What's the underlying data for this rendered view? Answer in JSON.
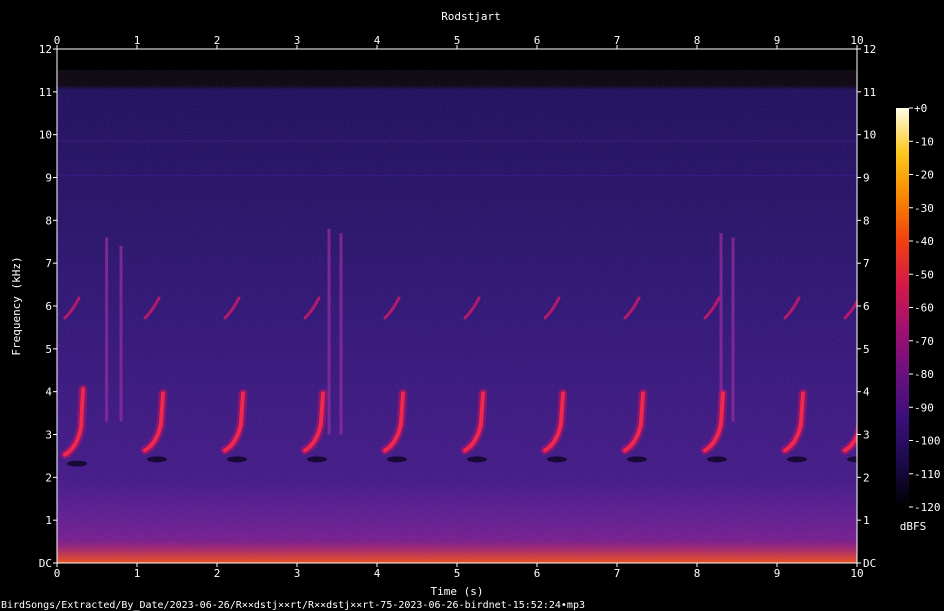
{
  "chart_data": {
    "type": "heatmap",
    "title": "Rodstjart",
    "xlabel": "Time (s)",
    "ylabel": "Frequency (kHz)",
    "xlim": [
      0,
      10
    ],
    "ylim": [
      0,
      12
    ],
    "x_ticks": [
      "0",
      "1",
      "2",
      "3",
      "4",
      "5",
      "6",
      "7",
      "8",
      "9",
      "10"
    ],
    "y_ticks": [
      "DC",
      "1",
      "2",
      "3",
      "4",
      "5",
      "6",
      "7",
      "8",
      "9",
      "10",
      "11",
      "12"
    ],
    "colorbar": {
      "label": "dBFS",
      "range": [
        -120,
        0
      ],
      "ticks": [
        "+0",
        "-10",
        "-20",
        "-30",
        "-40",
        "-50",
        "-60",
        "-70",
        "-80",
        "-90",
        "-100",
        "-110",
        "-120"
      ],
      "colors": [
        "#000000",
        "#1a0a4a",
        "#3a0f7a",
        "#6a1080",
        "#a01070",
        "#d4184a",
        "#f04010",
        "#f88800",
        "#fcc81e",
        "#fffde8"
      ]
    },
    "song_elements": [
      {
        "t": 0.2,
        "low_khz": 2.6,
        "high_khz": 4.2,
        "upper_khz": 6.0
      },
      {
        "t": 1.2,
        "low_khz": 2.7,
        "high_khz": 4.1,
        "upper_khz": 6.0
      },
      {
        "t": 2.2,
        "low_khz": 2.7,
        "high_khz": 4.1,
        "upper_khz": 6.0
      },
      {
        "t": 3.2,
        "low_khz": 2.7,
        "high_khz": 4.1,
        "upper_khz": 6.0
      },
      {
        "t": 4.2,
        "low_khz": 2.7,
        "high_khz": 4.1,
        "upper_khz": 6.0
      },
      {
        "t": 5.2,
        "low_khz": 2.7,
        "high_khz": 4.1,
        "upper_khz": 6.0
      },
      {
        "t": 6.2,
        "low_khz": 2.7,
        "high_khz": 4.1,
        "upper_khz": 6.0
      },
      {
        "t": 7.2,
        "low_khz": 2.7,
        "high_khz": 4.1,
        "upper_khz": 6.0
      },
      {
        "t": 8.2,
        "low_khz": 2.7,
        "high_khz": 4.1,
        "upper_khz": 6.0
      },
      {
        "t": 9.2,
        "low_khz": 2.7,
        "high_khz": 4.1,
        "upper_khz": 6.0
      },
      {
        "t": 9.95,
        "low_khz": 2.7,
        "high_khz": 3.5,
        "upper_khz": 6.0
      }
    ],
    "clicks": [
      {
        "t": 0.62,
        "low_khz": 3.3,
        "high_khz": 7.6
      },
      {
        "t": 0.8,
        "low_khz": 3.3,
        "high_khz": 7.4
      },
      {
        "t": 3.4,
        "low_khz": 3.0,
        "high_khz": 7.8
      },
      {
        "t": 3.55,
        "low_khz": 3.0,
        "high_khz": 7.7
      },
      {
        "t": 8.3,
        "low_khz": 3.3,
        "high_khz": 7.7
      },
      {
        "t": 8.45,
        "low_khz": 3.3,
        "high_khz": 7.6
      }
    ],
    "grid": false,
    "legend": "none"
  },
  "footer": {
    "path": "BirdSongs/Extracted/By_Date/2023-06-26/R××dstj××rt/R××dstj××rt-75-2023-06-26-birdnet-15:52:24•mp3"
  }
}
